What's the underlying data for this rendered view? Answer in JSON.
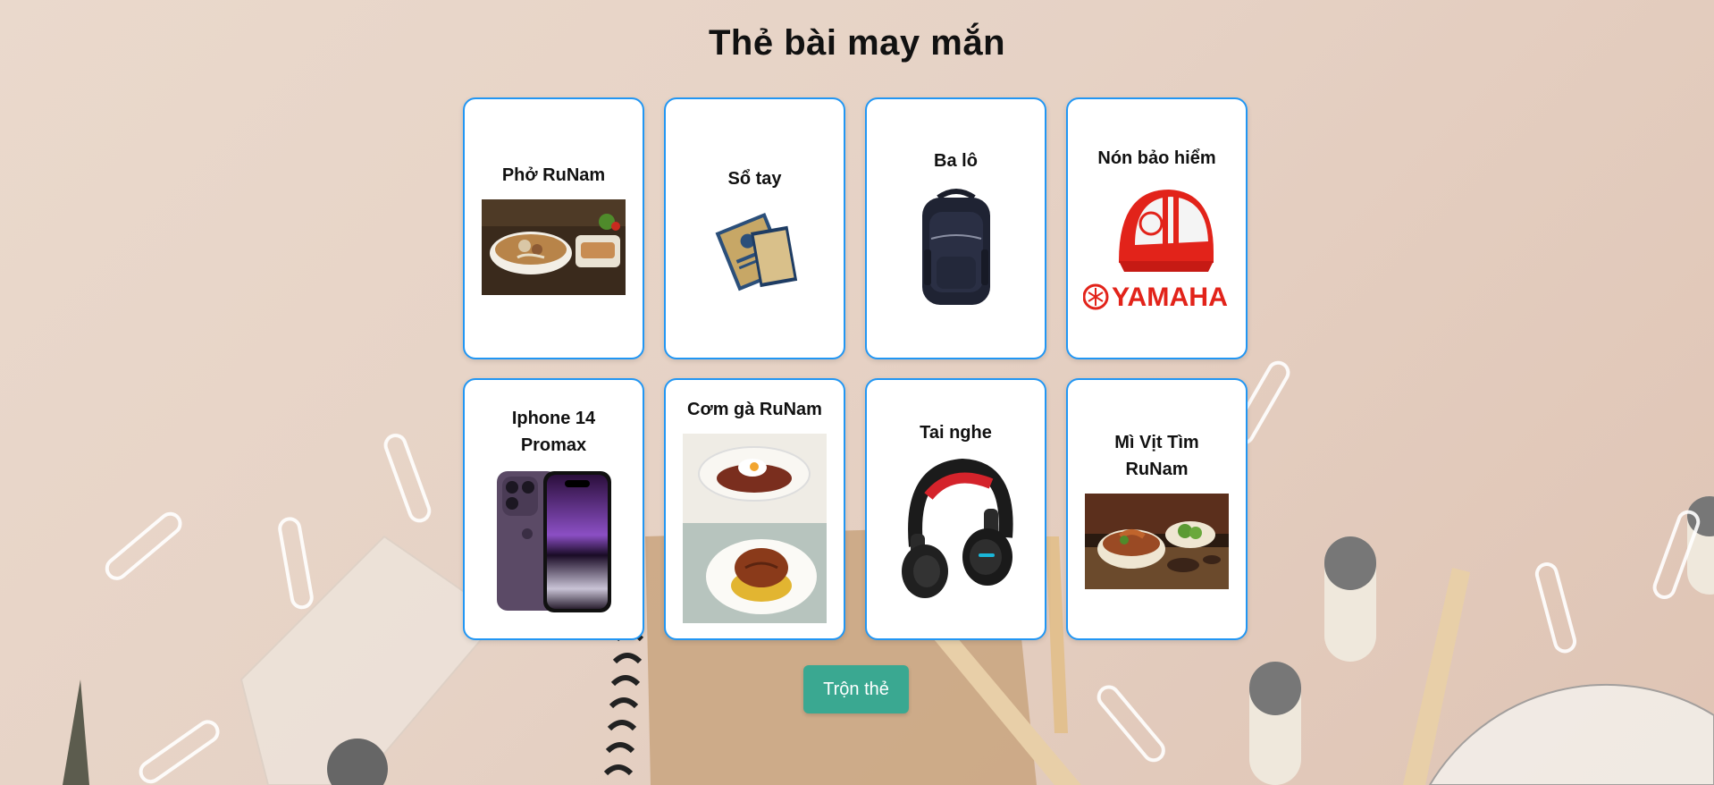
{
  "page": {
    "title": "Thẻ bài may mắn",
    "background_color": "#e6d2c5"
  },
  "cards": [
    {
      "label": "Phở RuNam",
      "icon": "pho-bowl-image"
    },
    {
      "label": "Sổ tay",
      "icon": "notebook-image"
    },
    {
      "label": "Ba lô",
      "icon": "backpack-image"
    },
    {
      "label": "Nón bảo hiểm",
      "icon": "helmet-image",
      "brand_text": "YAMAHA"
    },
    {
      "label": "Iphone 14 Promax",
      "icon": "iphone-image"
    },
    {
      "label": "Cơm gà RuNam",
      "icon": "chicken-rice-image"
    },
    {
      "label": "Tai nghe",
      "icon": "headphones-image"
    },
    {
      "label": "Mì Vịt Tìm RuNam",
      "icon": "duck-noodle-image"
    }
  ],
  "actions": {
    "shuffle_label": "Trộn thẻ"
  },
  "colors": {
    "card_border": "#2196f3",
    "button": "#3aa891",
    "helmet_red": "#e2231a"
  }
}
